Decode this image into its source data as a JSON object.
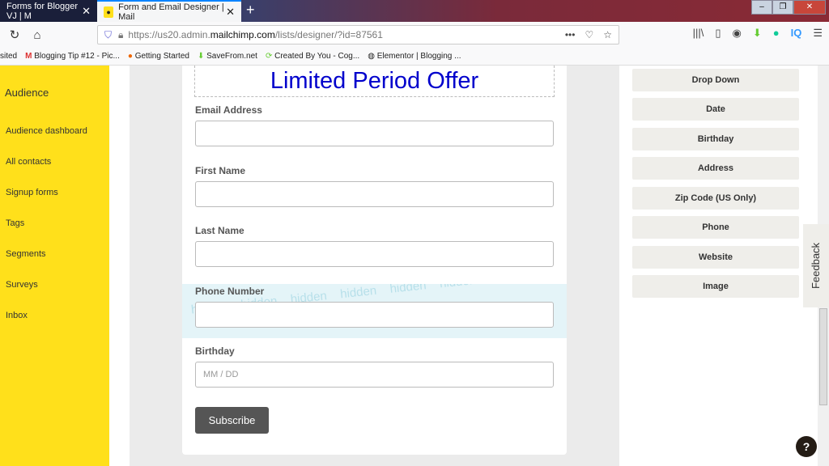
{
  "browser": {
    "tabs": [
      {
        "label": "Forms for Blogger VJ | M"
      },
      {
        "label": "Form and Email Designer | Mail"
      }
    ],
    "url_prefix": "https://us20.admin.",
    "url_domain": "mailchimp.com",
    "url_suffix": "/lists/designer/?id=87561",
    "bookmarks": [
      "sited",
      "Blogging Tip #12 - Pic...",
      "Getting Started",
      "SaveFrom.net",
      "Created By You - Cog...",
      "Elementor | Blogging ..."
    ],
    "toolbar_icons": [
      "library-icon",
      "sidebar-icon",
      "account-icon",
      "download-icon",
      "grammarly-icon",
      "iq-icon",
      "menu-icon"
    ]
  },
  "sidebar": {
    "heading": "Audience",
    "items": [
      "Audience dashboard",
      "All contacts",
      "Signup forms",
      "Tags",
      "Segments",
      "Surveys",
      "Inbox"
    ]
  },
  "form": {
    "title": "Limited Period Offer",
    "fields": [
      {
        "label": "Email Address"
      },
      {
        "label": "First Name"
      },
      {
        "label": "Last Name"
      },
      {
        "label": "Phone Number",
        "hidden_text": "hidden"
      },
      {
        "label": "Birthday",
        "placeholder": "MM / DD"
      }
    ],
    "submit": "Subscribe"
  },
  "panel": {
    "buttons": [
      "Drop Down",
      "Date",
      "Birthday",
      "Address",
      "Zip Code (US Only)",
      "Phone",
      "Website",
      "Image"
    ]
  },
  "feedback": "Feedback",
  "help": "?",
  "colors": {
    "sidebar": "#ffe01b",
    "title": "#0000cc",
    "hidden_bg": "#e4f4f8"
  }
}
